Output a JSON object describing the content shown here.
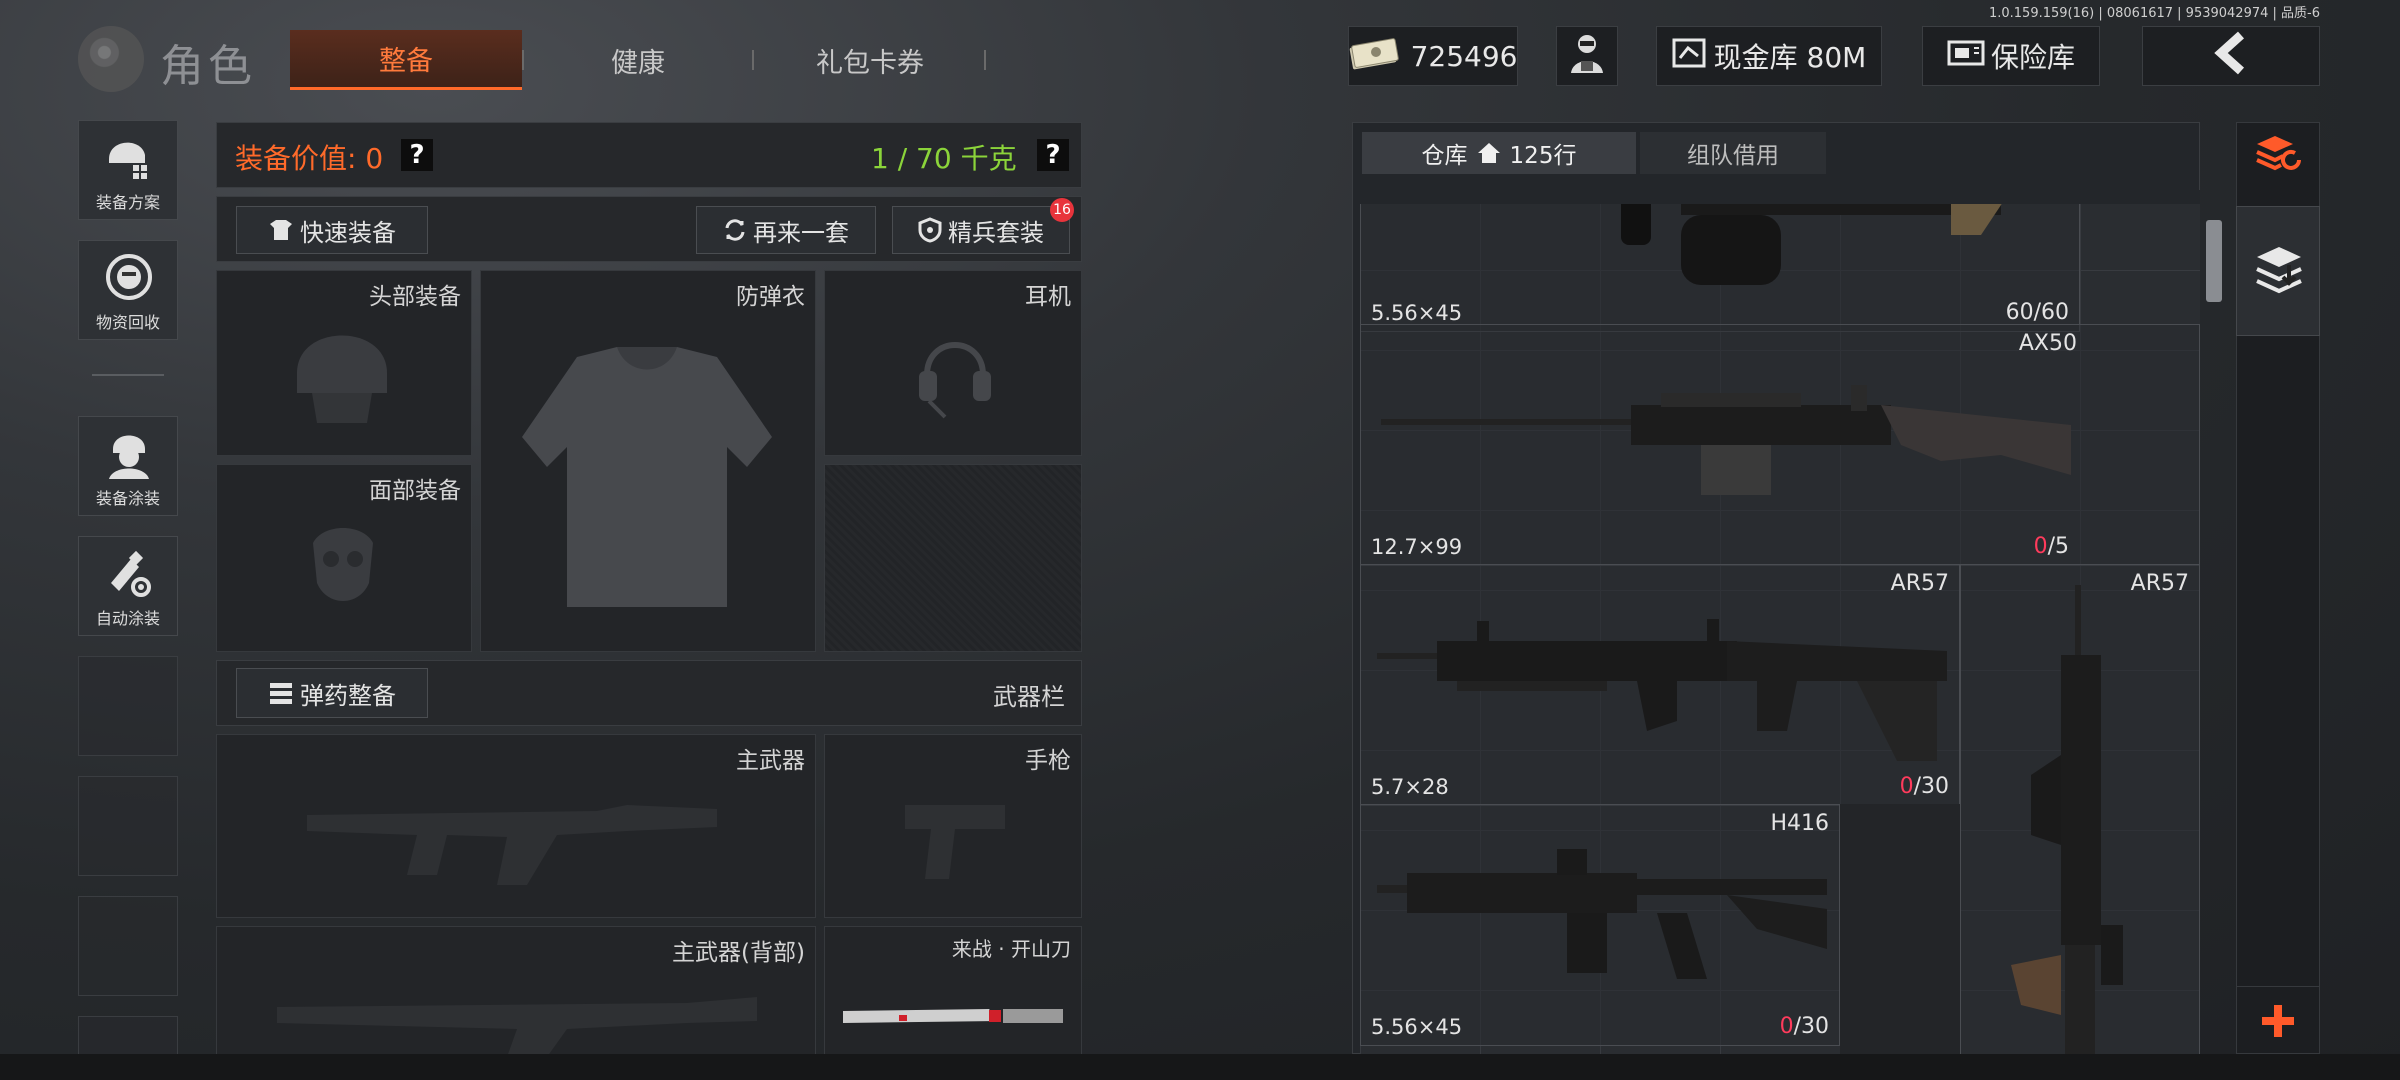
{
  "version": "1.0.159.159(16) | 08061617 | 9539042974 | 品质-6",
  "brand": {
    "title": "角色"
  },
  "tabs": [
    {
      "label": "整备",
      "active": true
    },
    {
      "label": "健康",
      "active": false
    },
    {
      "label": "礼包卡券",
      "active": false
    }
  ],
  "currency": {
    "amount": "725496"
  },
  "cash_vault": {
    "label": "现金库 80M"
  },
  "safe": {
    "label": "保险库"
  },
  "rail": [
    {
      "label": "装备方案",
      "icon": "helmet-grid-icon"
    },
    {
      "label": "物资回收",
      "icon": "recycle-face-icon"
    },
    {
      "label": "装备涂装",
      "icon": "soldier-icon"
    },
    {
      "label": "自动涂装",
      "icon": "spray-gear-icon"
    }
  ],
  "equipment": {
    "value_label": "装备价值: 0",
    "weight_label": "1 / 70 千克",
    "help": "?",
    "quick_equip": "快速装备",
    "reroll": "再来一套",
    "elite_set": "精兵套装",
    "elite_badge": "16",
    "slots": {
      "head": "头部装备",
      "armor": "防弹衣",
      "headset": "耳机",
      "face": "面部装备"
    },
    "ammo_prep": "弹药整备",
    "weapon_bar": "武器栏",
    "weapon_slots": {
      "primary": "主武器",
      "pistol": "手枪",
      "primary_back": "主武器(背部)",
      "melee": "来战 · 开山刀"
    }
  },
  "warehouse": {
    "tab_storage": "仓库",
    "tab_rows": "125行",
    "tab_team": "组队借用",
    "items": [
      {
        "name": "",
        "ammo": "5.56×45",
        "count_zero": "",
        "count_rest": "60/60"
      },
      {
        "name": "AX50",
        "ammo": "12.7×99",
        "count_zero": "0",
        "count_rest": "/5"
      },
      {
        "name": "AR57",
        "ammo": "5.7×28",
        "count_zero": "0",
        "count_rest": "/30"
      },
      {
        "name": "AR57",
        "ammo": "",
        "count_zero": "",
        "count_rest": ""
      },
      {
        "name": "H416",
        "ammo": "5.56×45",
        "count_zero": "0",
        "count_rest": "/30"
      }
    ]
  },
  "colors": {
    "accent": "#ff6a2a",
    "weight_ok": "#8bd43a",
    "zero_count": "#ff3b5c"
  }
}
